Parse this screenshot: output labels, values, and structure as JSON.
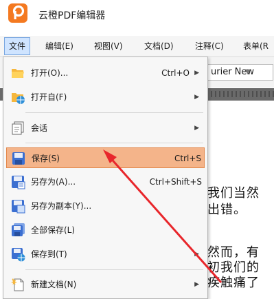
{
  "app": {
    "title": "云橙PDF编辑器"
  },
  "menubar": {
    "items": [
      {
        "label": "文件"
      },
      {
        "label": "编辑(E)"
      },
      {
        "label": "视图(V)"
      },
      {
        "label": "文档(D)"
      },
      {
        "label": "注释(C)"
      },
      {
        "label": "表单(R"
      }
    ]
  },
  "toolbar": {
    "font_value": "urier New"
  },
  "document": {
    "lines": [
      "我们当然",
      "出错。",
      "然而，有",
      "初我们的",
      "疾触痛了"
    ]
  },
  "file_menu": {
    "items": [
      {
        "label": "打开(O)...",
        "shortcut": "Ctrl+O",
        "icon": "folder-open-icon"
      },
      {
        "label": "打开自(F)",
        "shortcut": "",
        "icon": "open-from-web-icon"
      },
      {
        "label": "会话",
        "shortcut": "",
        "icon": "session-icon"
      },
      {
        "label": "保存(S)",
        "shortcut": "Ctrl+S",
        "icon": "save-icon"
      },
      {
        "label": "另存为(A)...",
        "shortcut": "Ctrl+Shift+S",
        "icon": "save-as-icon"
      },
      {
        "label": "另存为副本(Y)...",
        "shortcut": "",
        "icon": "save-copy-icon"
      },
      {
        "label": "全部保存(L)",
        "shortcut": "",
        "icon": "save-all-icon"
      },
      {
        "label": "保存到(T)",
        "shortcut": "",
        "icon": "save-to-icon"
      },
      {
        "label": "新建文档(N)",
        "shortcut": "",
        "icon": "new-document-icon"
      }
    ]
  },
  "colors": {
    "accent": "#f47920",
    "highlight": "#f4b48a",
    "annotation_arrow": "#e8262b"
  }
}
